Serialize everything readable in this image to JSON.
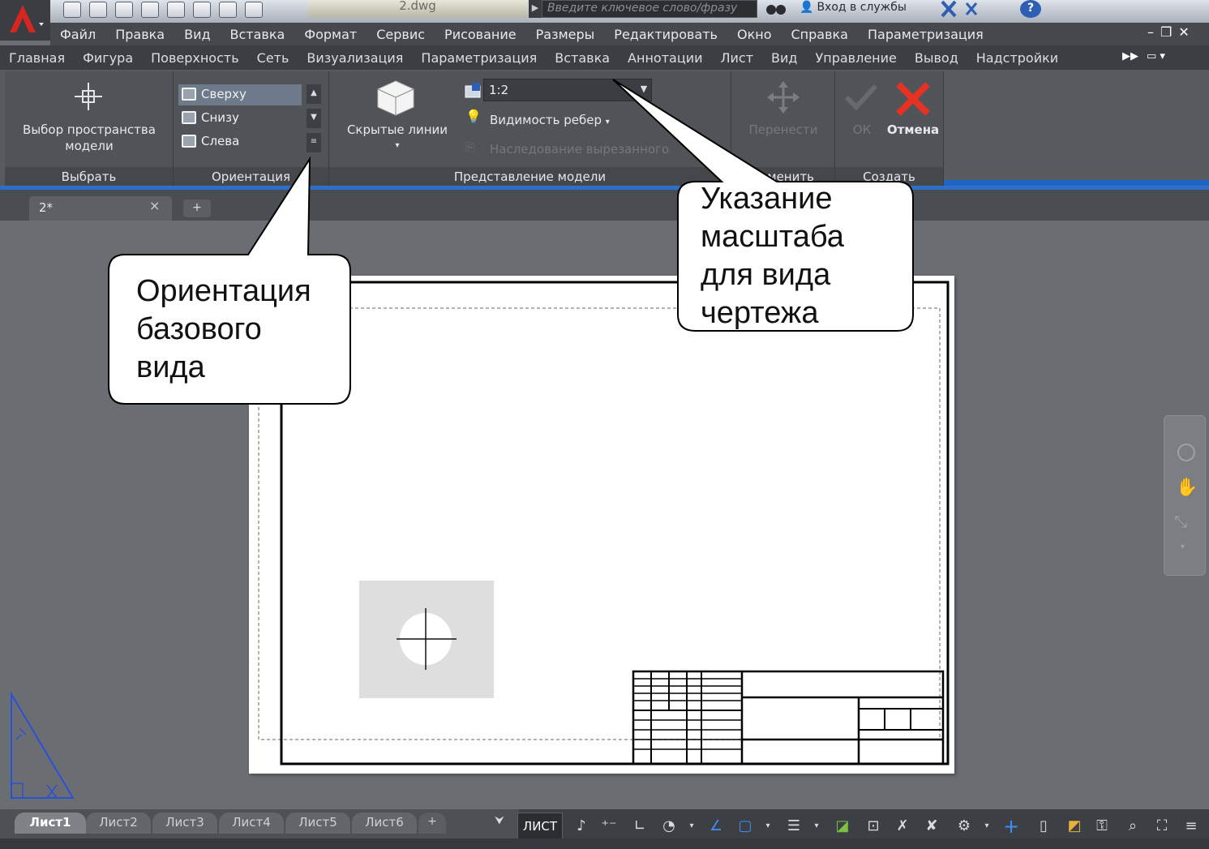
{
  "title_bar": {
    "document_name": "2.dwg",
    "search_placeholder": "Введите ключевое слово/фразу",
    "login_label": "Вход в службы"
  },
  "menu": {
    "items": [
      "Файл",
      "Правка",
      "Вид",
      "Вставка",
      "Формат",
      "Сервис",
      "Рисование",
      "Размеры",
      "Редактировать",
      "Окно",
      "Справка",
      "Параметризация"
    ]
  },
  "ribbon_tabs": [
    "Главная",
    "Фигура",
    "Поверхность",
    "Сеть",
    "Визуализация",
    "Параметризация",
    "Вставка",
    "Аннотации",
    "Лист",
    "Вид",
    "Управление",
    "Вывод",
    "Надстройки"
  ],
  "ribbon": {
    "select_panel": {
      "button_label_line1": "Выбор пространства",
      "button_label_line2": "модели",
      "title": "Выбрать"
    },
    "orientation_panel": {
      "items": [
        "Сверху",
        "Снизу",
        "Слева"
      ],
      "selected": "Сверху",
      "title": "Ориентация"
    },
    "model_view_panel": {
      "hidden_lines_label": "Скрытые линии",
      "scale_value": "1:2",
      "edge_visibility_label": "Видимость ребер",
      "inherit_cut_label": "Наследование вырезанного",
      "title": "Представление модели"
    },
    "modify_panel": {
      "move_label": "Перенести",
      "title": "Изменить"
    },
    "create_panel": {
      "ok_label": "ОК",
      "cancel_label": "Отмена",
      "title": "Создать"
    }
  },
  "document_tabs": {
    "active_tab": "2*",
    "close_glyph": "×",
    "add_glyph": "+"
  },
  "callouts": {
    "orientation": [
      "Ориентация",
      "базового",
      "вида"
    ],
    "scale": [
      "Указание",
      "масштаба",
      "для вида",
      "чертежа"
    ]
  },
  "layout_tabs": {
    "tabs": [
      "Лист1",
      "Лист2",
      "Лист3",
      "Лист4",
      "Лист5",
      "Лист6"
    ],
    "active": "Лист1",
    "add_glyph": "+"
  },
  "status_bar": {
    "space_label": "ЛИСТ"
  },
  "colors": {
    "accent_blue": "#2e6fc9",
    "cancel_red": "#e53222",
    "ribbon_bg": "#575a5f",
    "canvas_bg": "#6a6d72"
  }
}
